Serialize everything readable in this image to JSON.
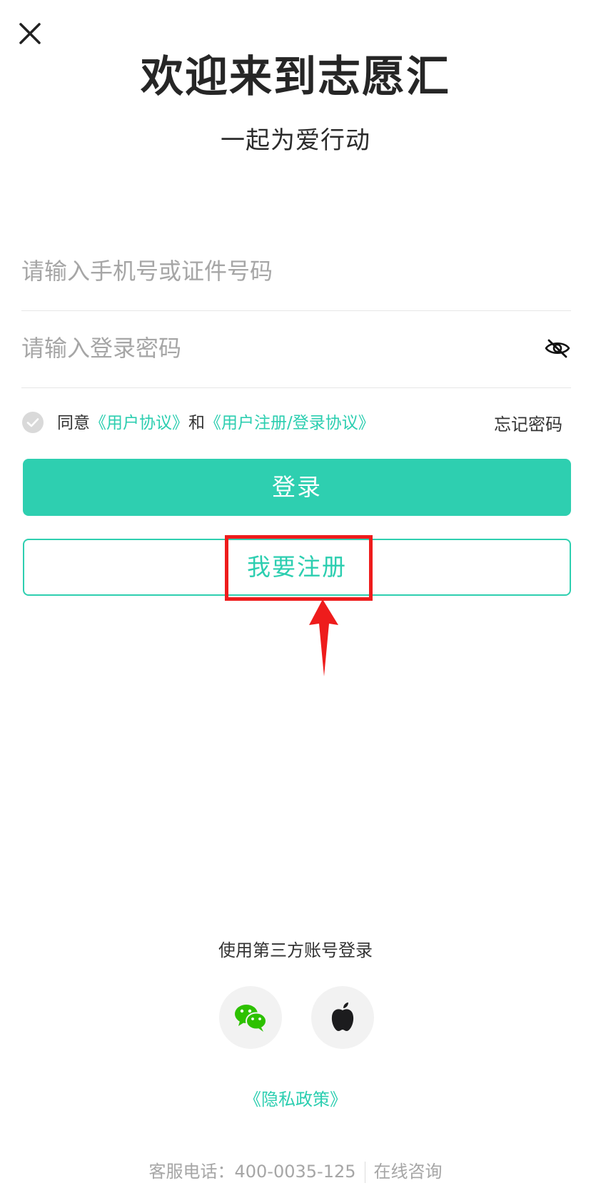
{
  "header": {
    "title": "欢迎来到志愿汇",
    "subtitle": "一起为爱行动",
    "close_icon": "close-icon"
  },
  "form": {
    "phone_placeholder": "请输入手机号或证件号码",
    "password_placeholder": "请输入登录密码",
    "password_visibility_icon": "eye-hidden-icon"
  },
  "agreement": {
    "checked": true,
    "prefix": "同意",
    "user_agreement_link": "《用户协议》",
    "conjunction": "和",
    "register_agreement_link": "《用户注册/登录协议》",
    "forgot_password": "忘记密码"
  },
  "buttons": {
    "login": "登录",
    "register": "我要注册"
  },
  "annotation": {
    "highlight_color": "#ee1c1c",
    "highlighted_element": "register-button"
  },
  "third_party": {
    "label": "使用第三方账号登录",
    "providers": [
      {
        "name": "wechat",
        "icon": "wechat-icon"
      },
      {
        "name": "apple",
        "icon": "apple-icon"
      }
    ]
  },
  "privacy_link": "《隐私政策》",
  "footer": {
    "hotline": "客服电话：400-0035-125",
    "consult": "在线咨询"
  },
  "colors": {
    "accent": "#2ecfb0",
    "text": "#333333",
    "placeholder": "#a6a6a6"
  }
}
